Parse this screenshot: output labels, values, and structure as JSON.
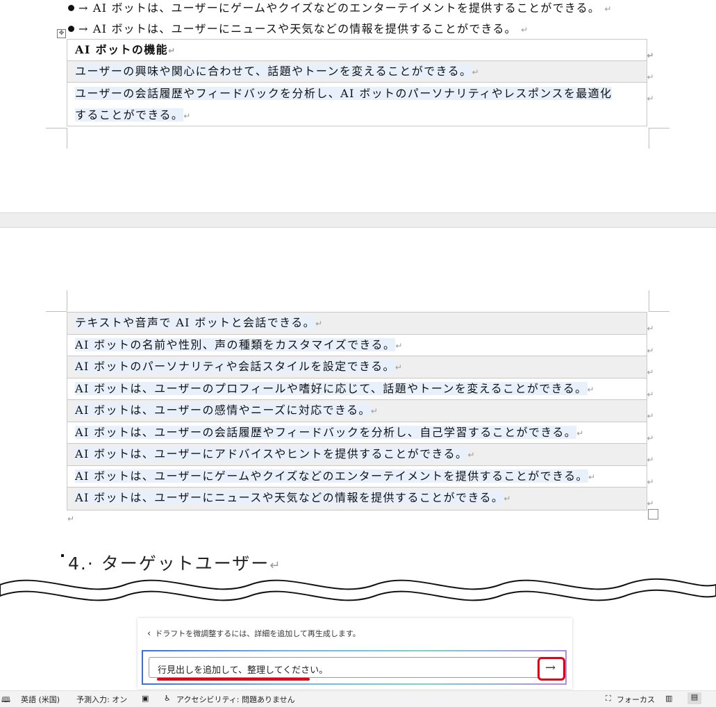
{
  "page1": {
    "bullets": [
      "→ AI ボットは、ユーザーにゲームやクイズなどのエンターテイメントを提供することができる。",
      "→ AI ボットは、ユーザーにニュースや天気などの情報を提供することができる。"
    ],
    "table_rows": [
      "AI ボットの機能",
      "ユーザーの興味や関心に合わせて、話題やトーンを変えることができる。",
      "ユーザーの会話履歴やフィードバックを分析し、AI ボットのパーソナリティやレスポンスを最適化",
      "することができる。"
    ]
  },
  "page2": {
    "table_rows": [
      "テキストや音声で AI ボットと会話できる。",
      "AI ボットの名前や性別、声の種類をカスタマイズできる。",
      "AI ボットのパーソナリティや会話スタイルを設定できる。",
      "AI ボットは、ユーザーのプロフィールや嗜好に応じて、話題やトーンを変えることができる。",
      "AI ボットは、ユーザーの感情やニーズに対応できる。",
      "AI ボットは、ユーザーの会話履歴やフィードバックを分析し、自己学習することができる。",
      "AI ボットは、ユーザーにアドバイスやヒントを提供することができる。",
      "AI ボットは、ユーザーにゲームやクイズなどのエンターテイメントを提供することができる。",
      "AI ボットは、ユーザーにニュースや天気などの情報を提供することができる。"
    ],
    "heading": "4.· ターゲットユーザー"
  },
  "marks": {
    "paragraph": "↵"
  },
  "copilot": {
    "back_icon": "chevron-left-icon",
    "hint": "ドラフトを微調整するには、詳細を追加して再生成します。",
    "input_value": "行見出しを追加して、整理してください。",
    "send_icon": "arrow-right-icon"
  },
  "status_bar": {
    "language": "英語 (米国)",
    "predict": "予測入力: オン",
    "accessibility": "アクセシビリティ: 問題ありません",
    "focus": "フォーカス"
  },
  "colors": {
    "highlight": "#e8f0fc",
    "shade": "#efefef",
    "accent_red": "#e60012"
  }
}
